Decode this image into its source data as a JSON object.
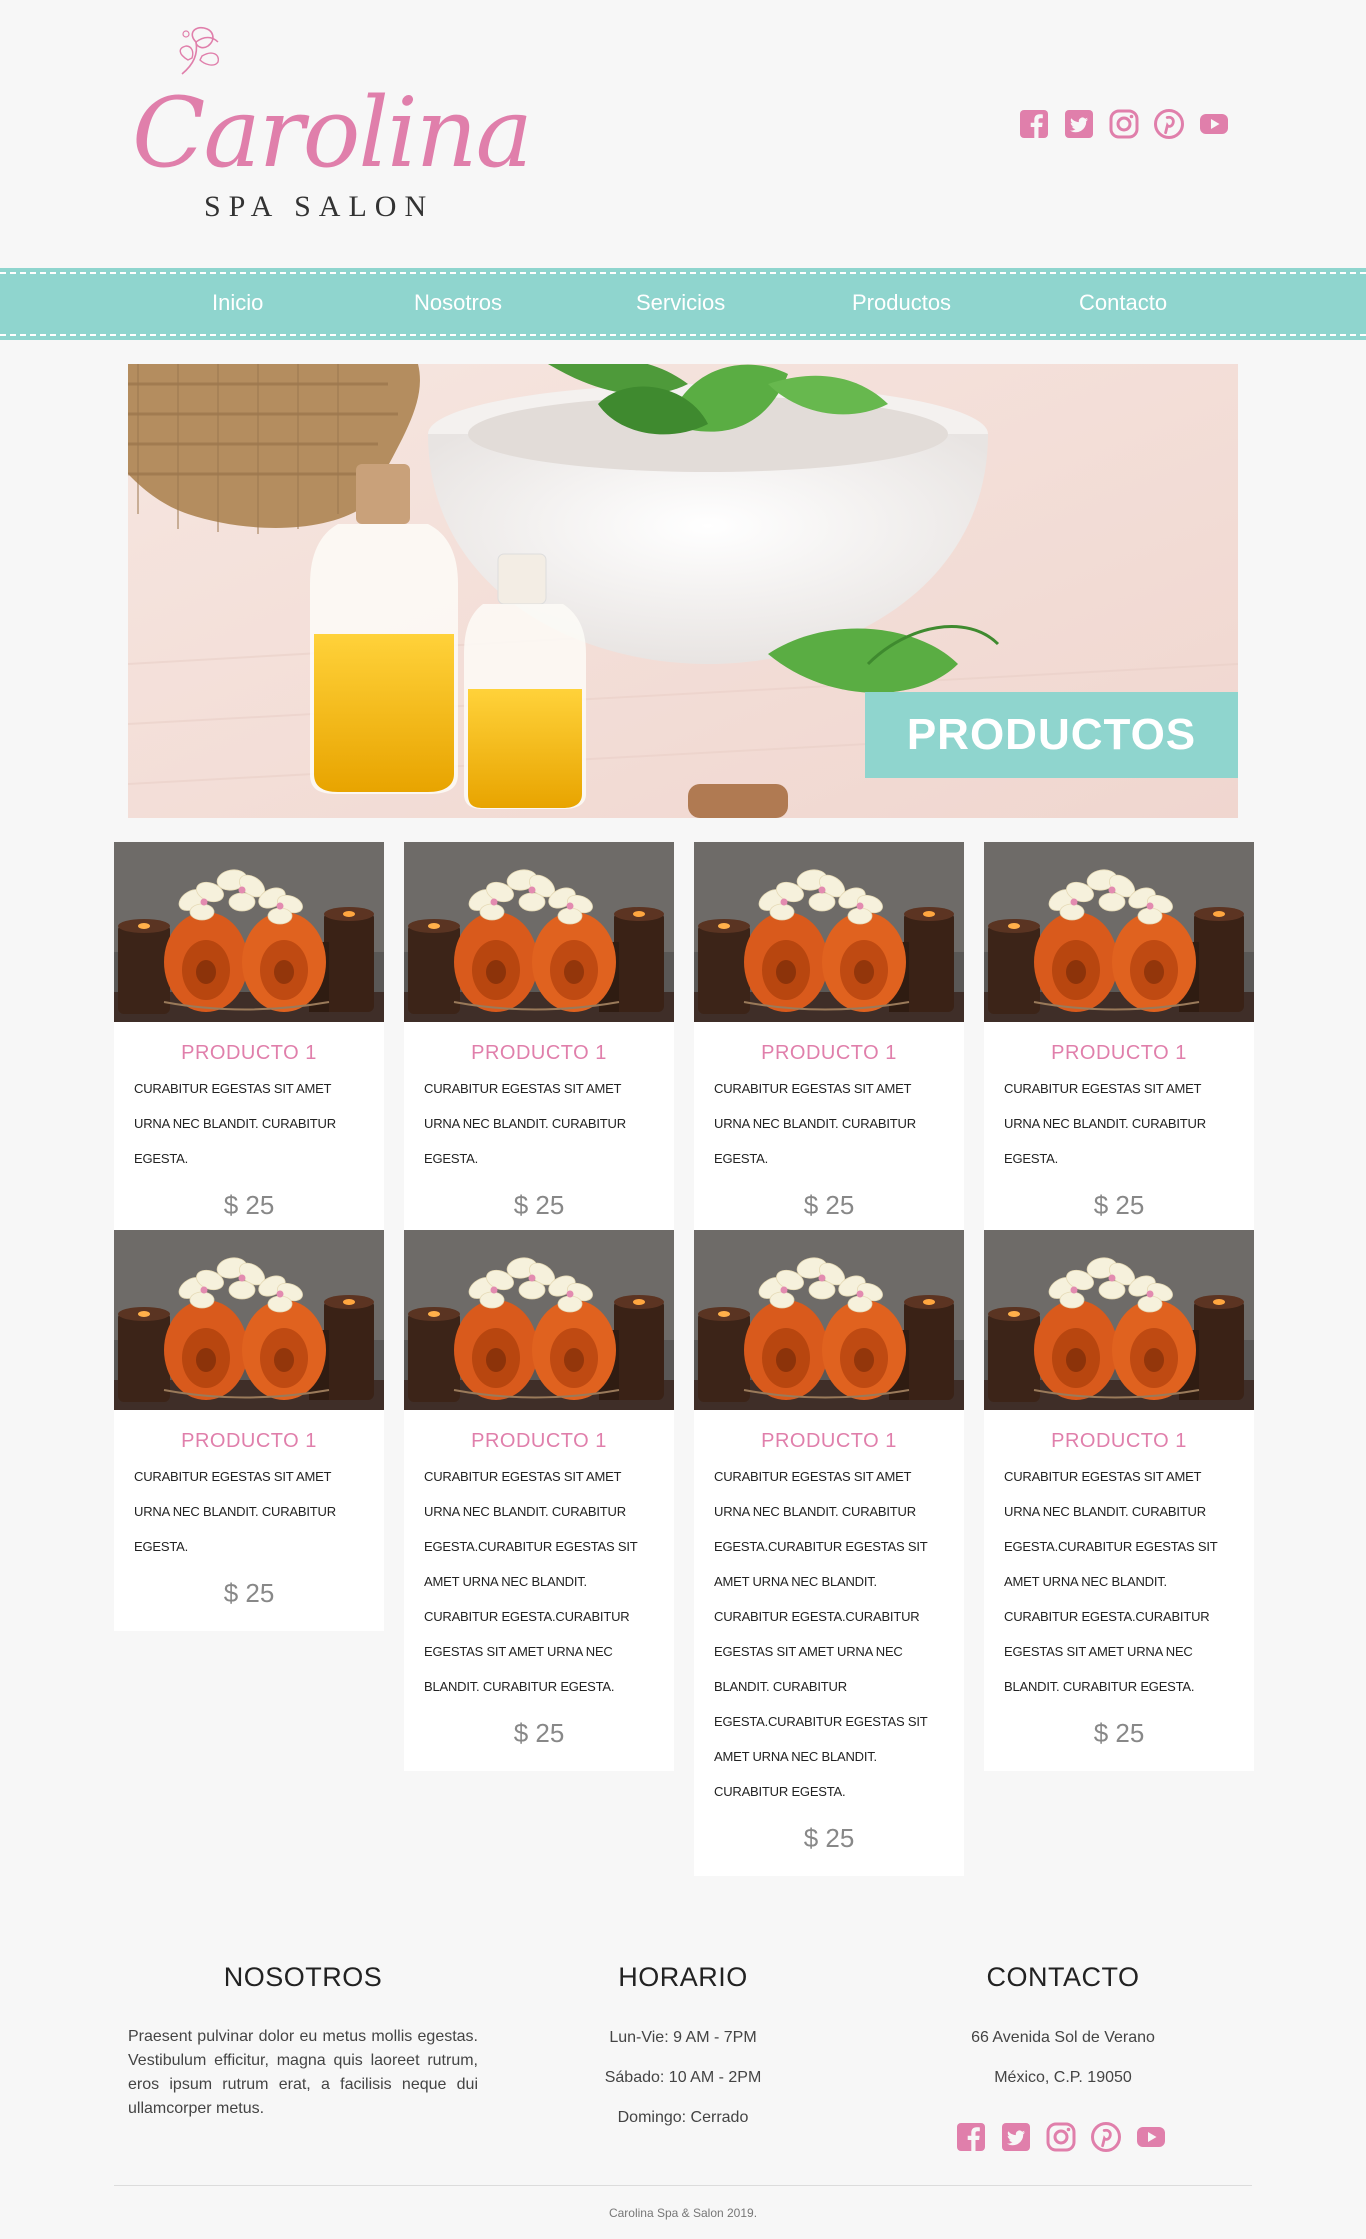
{
  "brand": {
    "script": "Carolina",
    "subtitle": "SPA SALON"
  },
  "colors": {
    "pink": "#e07fab",
    "teal": "#8fd5ce"
  },
  "social_icons": [
    "facebook-icon",
    "twitter-icon",
    "instagram-icon",
    "pinterest-icon",
    "youtube-icon"
  ],
  "nav": {
    "items": [
      "Inicio",
      "Nosotros",
      "Servicios",
      "Productos",
      "Contacto"
    ]
  },
  "banner": {
    "label": "PRODUCTOS"
  },
  "products": [
    {
      "title": "PRODUCTO 1",
      "desc": "CURABITUR EGESTAS SIT AMET URNA NEC BLANDIT. CURABITUR EGESTA.",
      "price": "$ 25"
    },
    {
      "title": "PRODUCTO 1",
      "desc": "CURABITUR EGESTAS SIT AMET URNA NEC BLANDIT. CURABITUR EGESTA.",
      "price": "$ 25"
    },
    {
      "title": "PRODUCTO 1",
      "desc": "CURABITUR EGESTAS SIT AMET URNA NEC BLANDIT. CURABITUR EGESTA.",
      "price": "$ 25"
    },
    {
      "title": "PRODUCTO 1",
      "desc": "CURABITUR EGESTAS SIT AMET URNA NEC BLANDIT. CURABITUR EGESTA.",
      "price": "$ 25"
    },
    {
      "title": "PRODUCTO 1",
      "desc": "CURABITUR EGESTAS SIT AMET URNA NEC BLANDIT. CURABITUR EGESTA.",
      "price": "$ 25"
    },
    {
      "title": "PRODUCTO 1",
      "desc": "CURABITUR EGESTAS SIT AMET URNA NEC BLANDIT. CURABITUR EGESTA.CURABITUR EGESTAS SIT AMET URNA NEC BLANDIT. CURABITUR EGESTA.CURABITUR EGESTAS SIT AMET URNA NEC BLANDIT. CURABITUR EGESTA.",
      "price": "$ 25"
    },
    {
      "title": "PRODUCTO 1",
      "desc": "CURABITUR EGESTAS SIT AMET URNA NEC BLANDIT. CURABITUR EGESTA.CURABITUR EGESTAS SIT AMET URNA NEC BLANDIT. CURABITUR EGESTA.CURABITUR EGESTAS SIT AMET URNA NEC BLANDIT. CURABITUR EGESTA.CURABITUR EGESTAS SIT AMET URNA NEC BLANDIT. CURABITUR EGESTA.",
      "price": "$ 25"
    },
    {
      "title": "PRODUCTO 1",
      "desc": "CURABITUR EGESTAS SIT AMET URNA NEC BLANDIT. CURABITUR EGESTA.CURABITUR EGESTAS SIT AMET URNA NEC BLANDIT. CURABITUR EGESTA.CURABITUR EGESTAS SIT AMET URNA NEC BLANDIT. CURABITUR EGESTA.",
      "price": "$ 25"
    }
  ],
  "footer": {
    "nosotros": {
      "title": "NOSOTROS",
      "text": "Praesent pulvinar dolor eu metus mollis egestas. Vestibulum efficitur, magna quis laoreet rutrum, eros ipsum rutrum erat, a facilisis neque dui ullamcorper metus."
    },
    "horario": {
      "title": "HORARIO",
      "lines": [
        "Lun-Vie: 9 AM - 7PM",
        "Sábado: 10 AM - 2PM",
        "Domingo: Cerrado"
      ]
    },
    "contacto": {
      "title": "CONTACTO",
      "lines": [
        "66 Avenida Sol de Verano",
        "México, C.P. 19050"
      ]
    },
    "copyright": "Carolina Spa & Salon 2019."
  }
}
